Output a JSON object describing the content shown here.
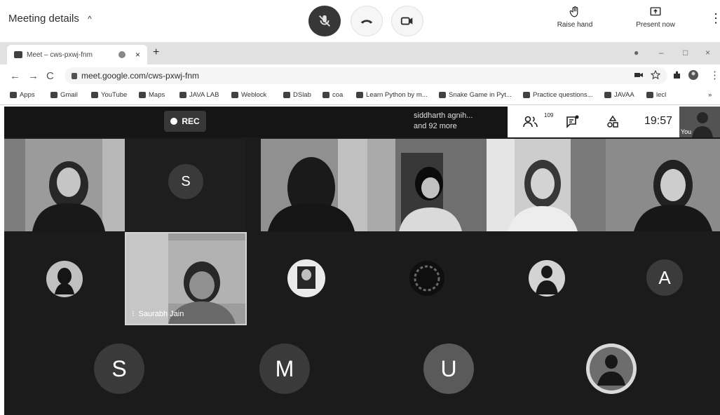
{
  "meet_header": {
    "meeting_details": "Meeting details",
    "raise_hand": "Raise hand",
    "present_now": "Present now"
  },
  "browser": {
    "tab_title": "Meet – cws-pxwj-fnm",
    "url": "meet.google.com/cws-pxwj-fnm",
    "bookmarks": [
      "Apps",
      "Gmail",
      "YouTube",
      "Maps",
      "JAVA LAB",
      "Weblock",
      "DSlab",
      "coa",
      "Learn Python by m...",
      "Snake Game in Pyt...",
      "Practice questions...",
      "JAVAA",
      "lecl"
    ]
  },
  "call": {
    "rec_label": "REC",
    "others_line1": "siddharth agnih...",
    "others_line2": "and 92 more",
    "participants_count": "109",
    "clock": "19:57",
    "self_label": "You"
  },
  "tiles": {
    "avatar_s1": "S",
    "named_participant": "Saurabh Jain",
    "avatar_a": "A",
    "avatar_s2": "S",
    "avatar_m": "M",
    "avatar_u": "U"
  }
}
